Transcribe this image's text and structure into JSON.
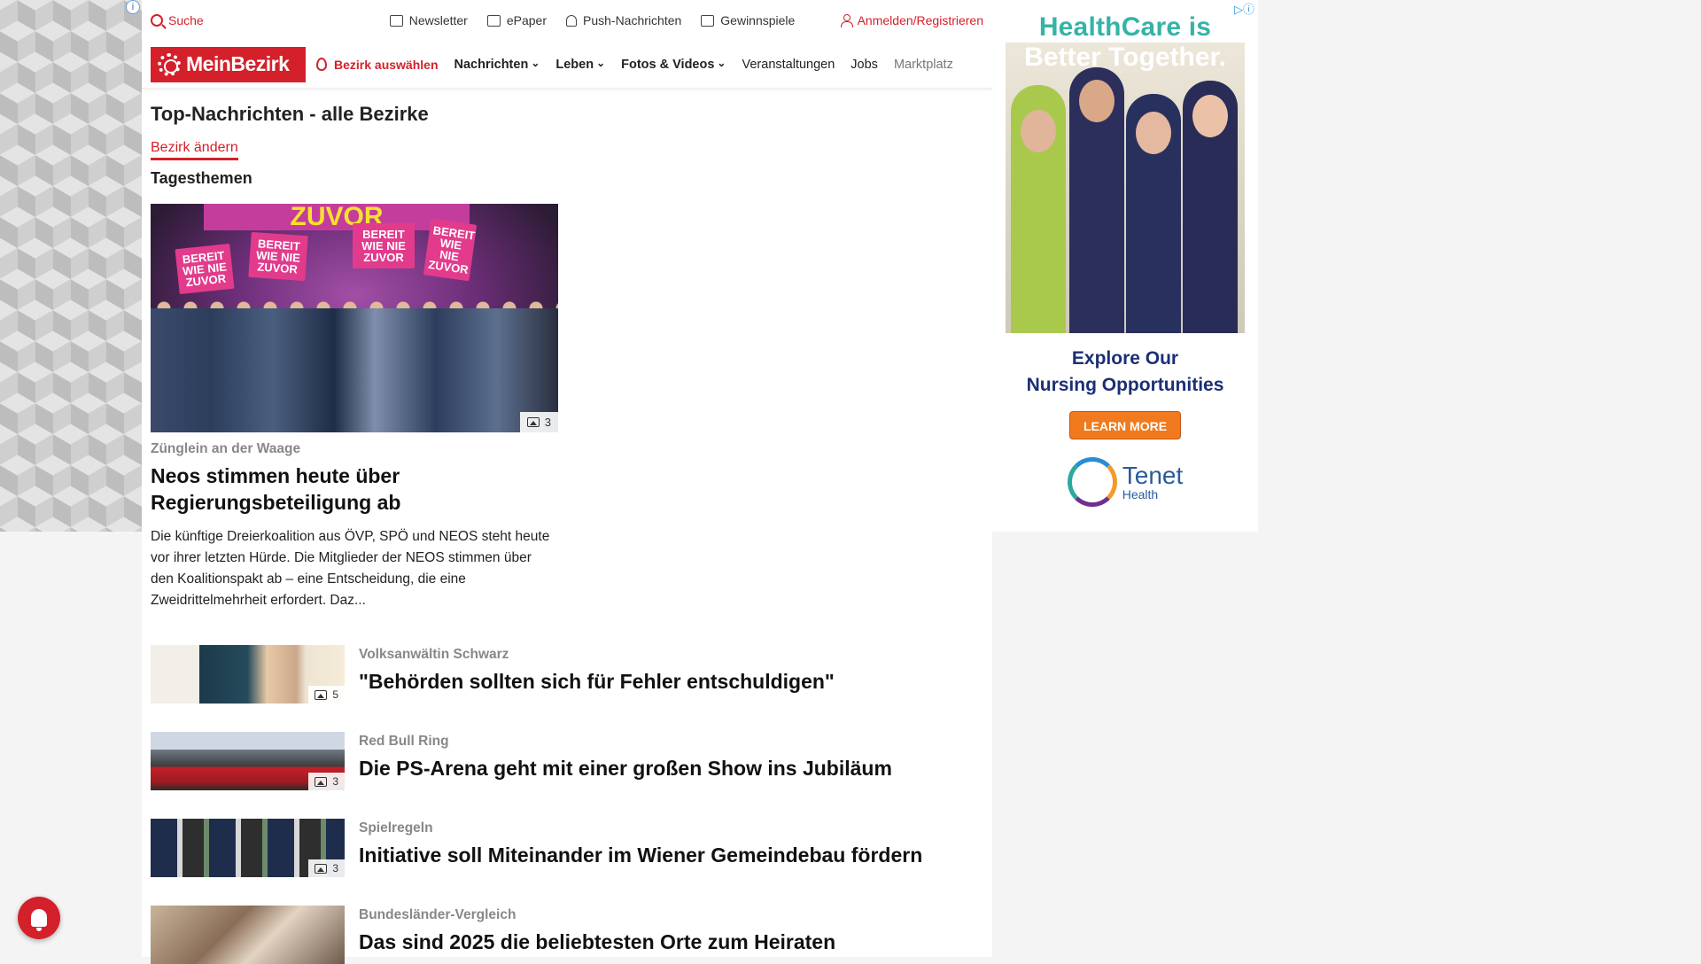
{
  "topbar": {
    "search_label": "Suche",
    "links": [
      {
        "label": "Newsletter",
        "icon": "mail-icon"
      },
      {
        "label": "ePaper",
        "icon": "epaper-icon"
      },
      {
        "label": "Push-Nachrichten",
        "icon": "bell-icon"
      },
      {
        "label": "Gewinnspiele",
        "icon": "gift-icon"
      }
    ],
    "login_label": "Anmelden/Registrieren"
  },
  "navbar": {
    "logo_text": "MeinBezirk",
    "bezirk_label": "Bezirk auswählen",
    "items": [
      {
        "label": "Nachrichten"
      },
      {
        "label": "Leben"
      },
      {
        "label": "Fotos & Videos"
      },
      {
        "label": "Veranstaltungen"
      },
      {
        "label": "Jobs"
      },
      {
        "label": "Marktplatz"
      }
    ]
  },
  "page": {
    "title": "Top-Nachrichten - alle Bezirke",
    "change_link": "Bezirk ändern",
    "section_title": "Tagesthemen"
  },
  "lead": {
    "image_banner": "ZUVOR",
    "signs": [
      "BEREIT WIE NIE ZUVOR",
      "BEREIT WIE NIE ZUVOR",
      "BEREIT WIE NIE ZUVOR",
      "BEREIT WIE NIE ZUVOR"
    ],
    "photo_count": "3",
    "kicker": "Zünglein an der Waage",
    "headline": "Neos stimmen heute über Regierungsbeteiligung ab",
    "teaser": "Die künftige Dreierkoalition aus ÖVP, SPÖ und NEOS steht heute vor ihrer letzten Hürde. Die Mitglieder der NEOS stimmen über den Koalitionspakt ab – eine Entscheidung, die eine Zweidrittelmehrheit erfordert. Daz..."
  },
  "articles": [
    {
      "kicker": "Volksanwältin Schwarz",
      "headline": "\"Behörden sollten sich für Fehler entschuldigen\"",
      "photo_count": "5"
    },
    {
      "kicker": "Red Bull Ring",
      "headline": "Die PS-Arena geht mit einer großen Show ins Jubiläum",
      "photo_count": "3"
    },
    {
      "kicker": "Spielregeln",
      "headline": "Initiative soll Miteinander im Wiener Gemeindebau fördern",
      "photo_count": "3"
    },
    {
      "kicker": "Bundesländer-Vergleich",
      "headline": "Das sind 2025 die beliebtesten Orte zum Heiraten",
      "photo_count": ""
    }
  ],
  "ad": {
    "headline_line1": "HealthCare is",
    "headline_line2": "Better Together.",
    "sub_line1": "Explore Our",
    "sub_line2": "Nursing Opportunities",
    "cta": "LEARN MORE",
    "brand_name": "Tenet",
    "brand_sub": "Health",
    "colors": {
      "teal": "#35b3a6",
      "navy": "#1b2f74",
      "orange": "#f07a1d"
    }
  },
  "colors": {
    "brand_red": "#d4202a"
  }
}
